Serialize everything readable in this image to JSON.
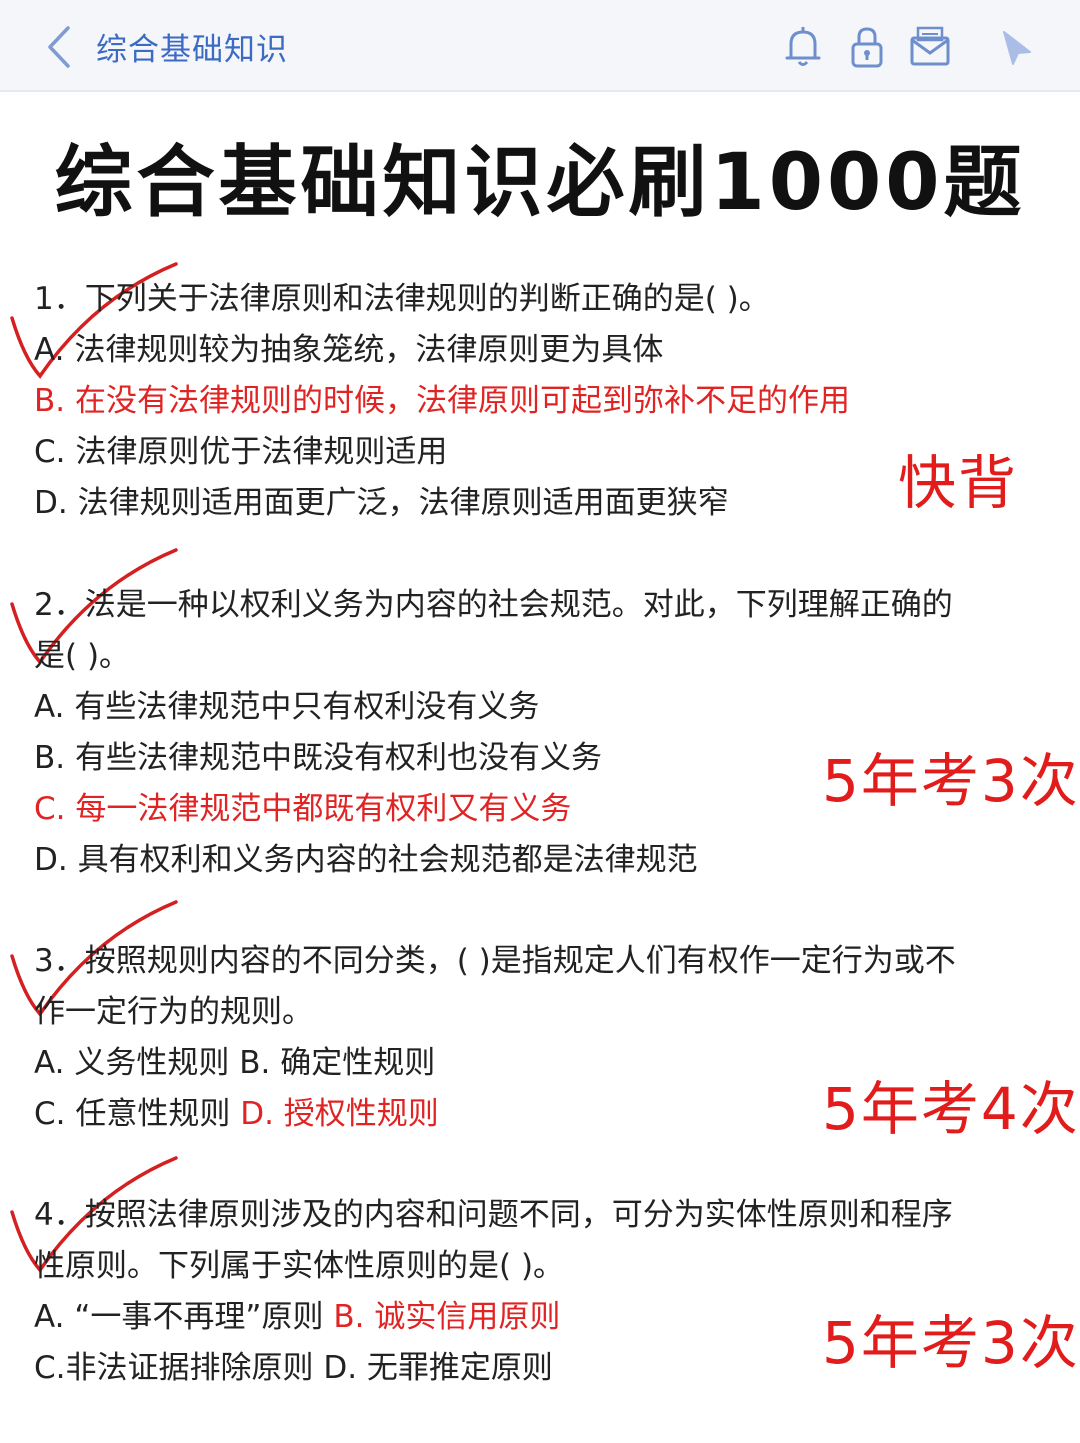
{
  "header": {
    "title": "综合基础知识",
    "icons": [
      "back-arrow-icon",
      "bell-icon",
      "lock-icon",
      "mail-icon",
      "cursor-icon"
    ]
  },
  "page_title": "综合基础知识必刷1000题",
  "questions": [
    {
      "stem": [
        "1．下列关于法律原则和法律规则的判断正确的是( )。"
      ],
      "options": [
        "A. 法律规则较为抽象笼统，法律原则更为具体",
        "B. 在没有法律规则的时候，法律原则可起到弥补不足的作用",
        "C. 法律原则优于法律规则适用",
        "D. 法律规则适用面更广泛，法律原则适用面更狭窄"
      ],
      "note": "快背"
    },
    {
      "stem": [
        "2．法是一种以权利义务为内容的社会规范。对此，下列理解正确的",
        "是( )。"
      ],
      "options": [
        "A. 有些法律规范中只有权利没有义务",
        "B. 有些法律规范中既没有权利也没有义务",
        "C. 每一法律规范中都既有权利又有义务",
        "D. 具有权利和义务内容的社会规范都是法律规范"
      ],
      "note": "5年考3次"
    },
    {
      "stem": [
        "3．按照规则内容的不同分类，( )是指规定人们有权作一定行为或不",
        "作一定行为的规则。"
      ],
      "options": [
        "A. 义务性规则 B. 确定性规则",
        "C. 任意性规则 ",
        "D. 授权性规则"
      ],
      "note": "5年考4次"
    },
    {
      "stem": [
        "4．按照法律原则涉及的内容和问题不同，可分为实体性原则和程序",
        "性原则。下列属于实体性原则的是( )。"
      ],
      "options": [
        "A. “一事不再理”原则 ",
        "B. 诚实信用原则",
        "C.非法证据排除原则 D. 无罪推定原则"
      ],
      "note": "5年考3次"
    }
  ],
  "colors": {
    "answer_red": "#e02424",
    "header_blue": "#3d6bc4",
    "check_red": "#d42020"
  }
}
